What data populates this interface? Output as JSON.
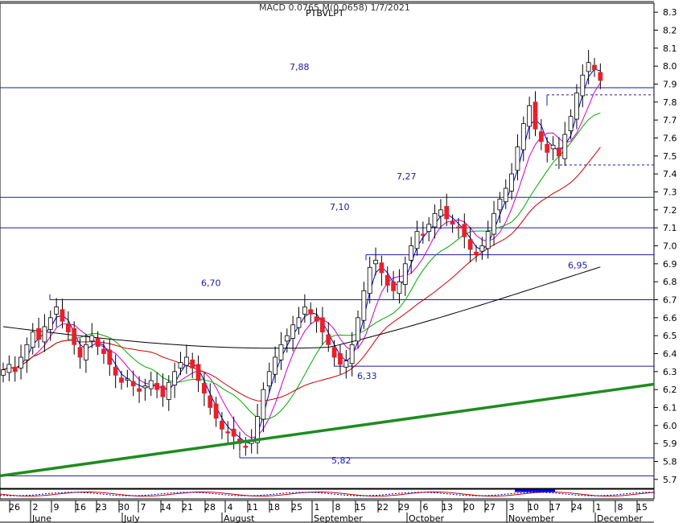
{
  "header": {
    "title": "PTBVLPT",
    "overlay": "MACD 0.0765 M(0.0658) 1/7/2021"
  },
  "chart_data": {
    "type": "candlestick",
    "y_axis": {
      "min": 5.65,
      "max": 8.35,
      "ticks": [
        "5.7",
        "5.8",
        "5.9",
        "6.0",
        "6.1",
        "6.2",
        "6.3",
        "6.4",
        "6.5",
        "6.6",
        "6.7",
        "6.8",
        "6.9",
        "7.0",
        "7.1",
        "7.2",
        "7.3",
        "7.4",
        "7.5",
        "7.6",
        "7.7",
        "7.8",
        "7.9",
        "8.0",
        "8.1",
        "8.2",
        "8.3"
      ]
    },
    "x_axis": {
      "day_labels": [
        "26",
        "2",
        "9",
        "16",
        "23",
        "30",
        "7",
        "14",
        "21",
        "28",
        "4",
        "11",
        "18",
        "25",
        "1",
        "8",
        "15",
        "22",
        "29",
        "6",
        "13",
        "20",
        "27",
        "3",
        "10",
        "17",
        "24",
        "1",
        "8",
        "15"
      ],
      "month_labels": [
        "June",
        "July",
        "August",
        "September",
        "October",
        "November",
        "December"
      ]
    },
    "level_lines": [
      {
        "label": "7,88",
        "value": 7.88
      },
      {
        "label": "7,27",
        "value": 7.27
      },
      {
        "label": "7,10",
        "value": 7.1
      },
      {
        "label": "6,95",
        "value": 6.95
      },
      {
        "label": "6,70",
        "value": 6.7
      },
      {
        "label": "6,33",
        "value": 6.33
      },
      {
        "label": "5,82",
        "value": 5.82
      }
    ],
    "dashed_levels": [
      7.84,
      7.45
    ],
    "trend_line": {
      "from": 5.72,
      "to": 6.23
    },
    "closes": [
      6.31,
      6.34,
      6.3,
      6.38,
      6.45,
      6.52,
      6.48,
      6.55,
      6.6,
      6.66,
      6.58,
      6.52,
      6.45,
      6.38,
      6.45,
      6.5,
      6.44,
      6.4,
      6.34,
      6.28,
      6.24,
      6.26,
      6.22,
      6.19,
      6.22,
      6.25,
      6.2,
      6.16,
      6.24,
      6.3,
      6.35,
      6.38,
      6.32,
      6.25,
      6.18,
      6.1,
      6.04,
      5.98,
      5.96,
      5.94,
      5.9,
      5.88,
      5.92,
      6.05,
      6.2,
      6.3,
      6.38,
      6.45,
      6.5,
      6.56,
      6.6,
      6.66,
      6.62,
      6.58,
      6.52,
      6.45,
      6.38,
      6.34,
      6.36,
      6.45,
      6.6,
      6.75,
      6.88,
      6.92,
      6.85,
      6.78,
      6.75,
      6.8,
      6.9,
      7.0,
      7.08,
      7.06,
      7.12,
      7.18,
      7.2,
      7.15,
      7.12,
      7.1,
      7.05,
      6.98,
      6.95,
      7.0,
      7.08,
      7.18,
      7.26,
      7.32,
      7.4,
      7.55,
      7.68,
      7.78,
      7.65,
      7.58,
      7.52,
      7.56,
      7.5,
      7.62,
      7.72,
      7.85,
      7.95,
      8.02,
      7.98,
      7.92
    ],
    "ma_lines": [
      {
        "name": "MA5",
        "color": "#0000cc"
      },
      {
        "name": "MA10",
        "color": "#cc00cc"
      },
      {
        "name": "MA20",
        "color": "#00aa00"
      },
      {
        "name": "MA50",
        "color": "#cc0000"
      },
      {
        "name": "MA200",
        "color": "#000000"
      }
    ],
    "macd_panel": {
      "shown": true
    }
  }
}
